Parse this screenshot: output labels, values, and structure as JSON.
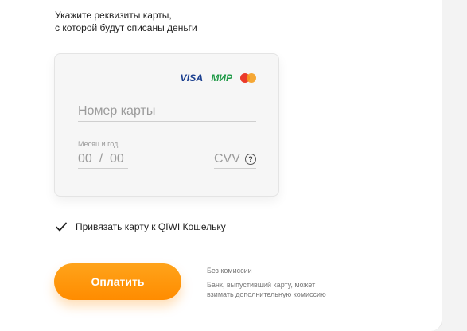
{
  "intro": {
    "line1": "Укажите реквизиты карты,",
    "line2": "с которой будут списаны деньги"
  },
  "card": {
    "logos": {
      "visa": "VISA",
      "mir": "МИР",
      "mastercard_icon": "mastercard-icon"
    },
    "number_placeholder": "Номер карты",
    "expiry_label": "Месяц и год",
    "expiry_placeholder": "00  /  00",
    "cvv_placeholder": "CVV",
    "cvv_help": "?"
  },
  "link_wallet": {
    "checked": true,
    "label": "Привязать карту к QIWI Кошельку"
  },
  "pay_button": {
    "label": "Оплатить"
  },
  "fee_note": {
    "line1": "Без комиссии",
    "line2": "Банк, выпустивший карту, может",
    "line3": "взимать дополнительную комиссию"
  },
  "colors": {
    "accent": "#ff8c00",
    "visa": "#1a3f8f",
    "mir": "#1f9a47"
  }
}
